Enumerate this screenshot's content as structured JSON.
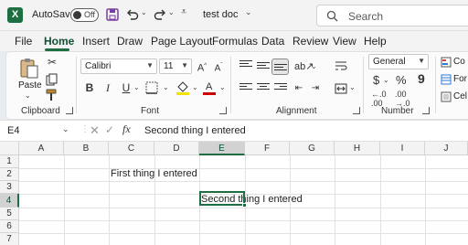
{
  "titlebar": {
    "autosave_label": "AutoSave",
    "autosave_state": "Off",
    "doc_title": "test doc",
    "search_placeholder": "Search"
  },
  "menu": {
    "tabs": [
      "File",
      "Home",
      "Insert",
      "Draw",
      "Page Layout",
      "Formulas",
      "Data",
      "Review",
      "View",
      "Help"
    ],
    "active": "Home"
  },
  "ribbon": {
    "clipboard": {
      "paste_label": "Paste",
      "group_label": "Clipboard"
    },
    "font": {
      "family": "Calibri",
      "size": "11",
      "group_label": "Font"
    },
    "alignment": {
      "group_label": "Alignment"
    },
    "number": {
      "format": "General",
      "group_label": "Number",
      "currency": "$",
      "percent": "%",
      "comma": "9"
    },
    "styles": {
      "item1": "Co",
      "item2": "For",
      "item3": "Cel"
    }
  },
  "formula_bar": {
    "name_box": "E4",
    "fx": "fx",
    "content": "Second thing I entered"
  },
  "grid": {
    "columns": [
      "A",
      "B",
      "C",
      "D",
      "E",
      "F",
      "G",
      "H",
      "I",
      "J"
    ],
    "rows": [
      "1",
      "2",
      "3",
      "4",
      "5",
      "6",
      "7"
    ],
    "selected_column": "E",
    "selected_row": "4",
    "cells": {
      "c2": "First thing I entered",
      "e4": "Second thing I entered"
    }
  }
}
